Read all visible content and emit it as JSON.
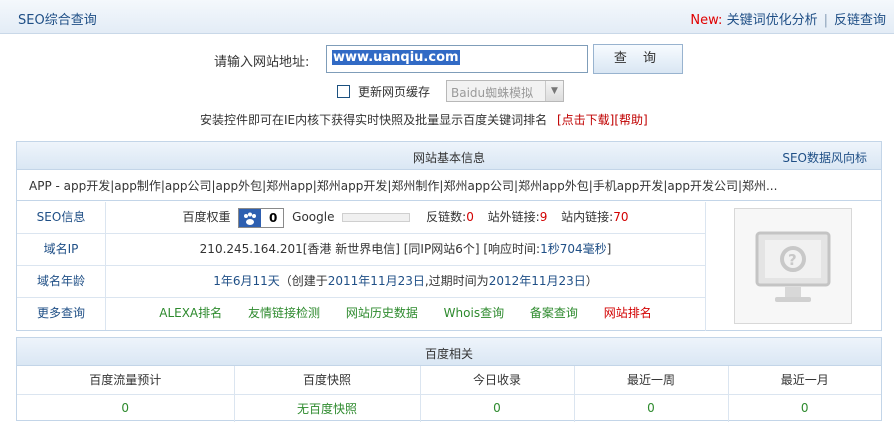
{
  "header": {
    "title": "SEO综合查询",
    "new_label": "New:",
    "link1": "关键词优化分析",
    "separator": "|",
    "link2": "反链查询"
  },
  "search": {
    "label": "请输入网站地址:",
    "value": "www.uanqiu.com",
    "button": "查 询",
    "cache_label": "更新网页缓存",
    "spider_option": "Baidu蜘蛛模拟",
    "tip_text": "安装控件即可在IE内核下获得实时快照及批量显示百度关键词排名",
    "download_link": "[点击下载]",
    "help_link": "[帮助]"
  },
  "basic": {
    "title": "网站基本信息",
    "trend_link": "SEO数据风向标",
    "keywords": "APP - app开发|app制作|app公司|app外包|郑州app|郑州app开发|郑州制作|郑州app公司|郑州app外包|手机app开发|app开发公司|郑州...",
    "seo": {
      "label": "SEO信息",
      "baidu_weight_label": "百度权重",
      "baidu_weight": "0",
      "google_label": "Google",
      "backlinks_label": "反链数:",
      "backlinks": "0",
      "outlinks_label": "站外链接:",
      "outlinks": "9",
      "inlinks_label": "站内链接:",
      "inlinks": "70"
    },
    "ip": {
      "label": "域名IP",
      "ip": "210.245.164.201",
      "location": "[香港 新世界电信]",
      "same_ip": "[同IP网站6个]",
      "resp_label": "[响应时间:",
      "resp_value": "1秒704毫秒",
      "resp_end": "]"
    },
    "age": {
      "label": "域名年龄",
      "age": "1年6月11天",
      "created_prefix": "（创建于",
      "created": "2011年11月23日",
      "expire_prefix": ",过期时间为",
      "expire": "2012年11月23日",
      "suffix": "）"
    },
    "more": {
      "label": "更多查询",
      "links": [
        "ALEXA排名",
        "友情链接检测",
        "网站历史数据",
        "Whois查询",
        "备案查询",
        "网站排名"
      ]
    }
  },
  "baidu": {
    "title": "百度相关",
    "headers": [
      "百度流量预计",
      "百度快照",
      "今日收录",
      "最近一周",
      "最近一月"
    ],
    "values": [
      "0",
      "无百度快照",
      "0",
      "0",
      "0"
    ]
  }
}
